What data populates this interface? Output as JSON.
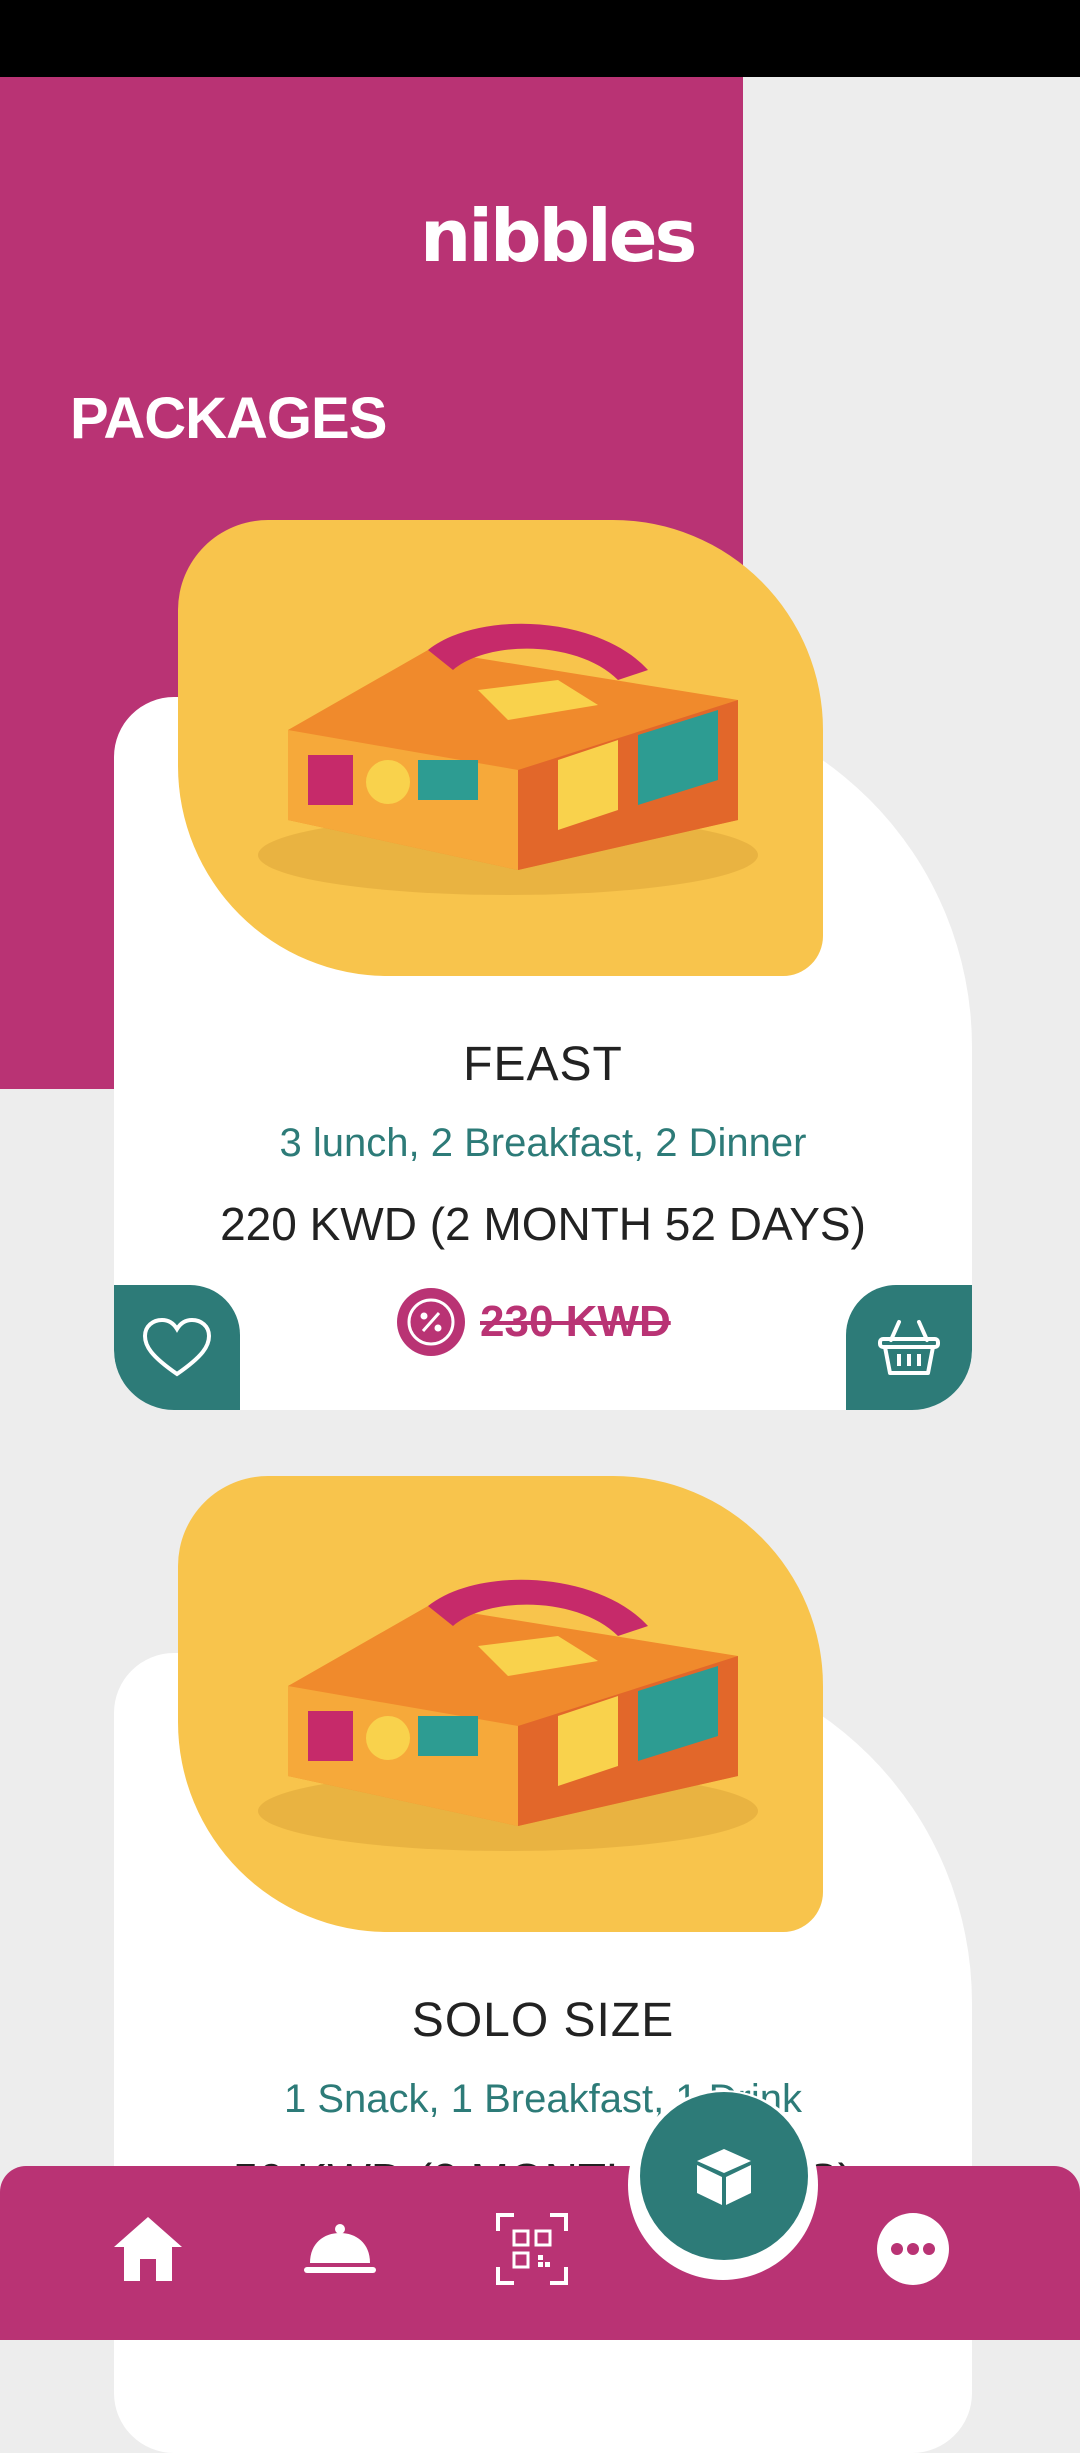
{
  "app": {
    "logo_text": "nibbles",
    "page_title": "PACKAGES"
  },
  "packages": [
    {
      "name": "FEAST",
      "description": "3 lunch, 2 Breakfast, 2 Dinner",
      "price": "220 KWD (2 MONTH 52 DAYS)",
      "old_price": "230 KWD"
    },
    {
      "name": "SOLO SIZE",
      "description": "1 Snack, 1 Breakfast, 1 Drink",
      "price": "50 KWD (2 MONTH 52 DAYS)"
    }
  ],
  "icons": {
    "discount": "percent-badge-icon",
    "favorite": "heart-icon",
    "cart": "basket-icon",
    "home": "home-icon",
    "dishes": "cloche-icon",
    "qr": "qr-code-icon",
    "packages": "box-icon",
    "more": "more-icon"
  },
  "colors": {
    "brand": "#b93374",
    "accent": "#2d7b78",
    "card_image_bg": "#f8c44c",
    "page_bg": "#ededed"
  }
}
